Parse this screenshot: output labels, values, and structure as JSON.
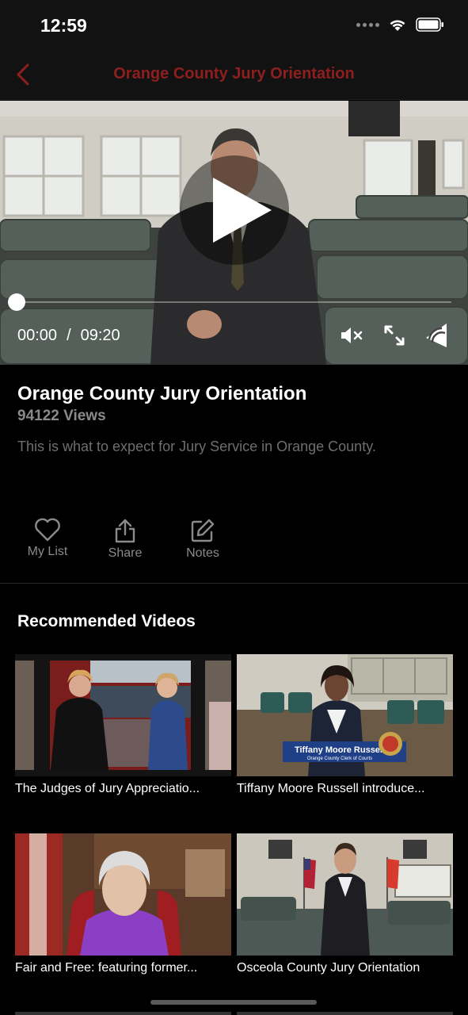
{
  "status_bar": {
    "time": "12:59"
  },
  "nav": {
    "title": "Orange County Jury Orientation",
    "accent": "#8f1f1f"
  },
  "player": {
    "current_time": "00:00",
    "separator": "/",
    "duration": "09:20",
    "progress": 0,
    "icons": [
      "play-icon",
      "mute-icon",
      "fullscreen-icon",
      "cast-icon"
    ]
  },
  "video": {
    "title": "Orange County Jury Orientation",
    "views": "94122 Views",
    "description": "This is what to expect for Jury Service in Orange County."
  },
  "actions": [
    {
      "label": "My List",
      "icon": "heart-icon"
    },
    {
      "label": "Share",
      "icon": "share-icon"
    },
    {
      "label": "Notes",
      "icon": "edit-icon"
    }
  ],
  "recommended": {
    "heading": "Recommended Videos",
    "items": [
      {
        "title": "The Judges of Jury Appreciatio..."
      },
      {
        "title": "Tiffany Moore Russell introduce...",
        "lower_third_name": "Tiffany Moore Russell",
        "lower_third_sub": "Orange County Clerk of Courts"
      },
      {
        "title": "Fair and Free: featuring former..."
      },
      {
        "title": "Osceola County Jury Orientation"
      }
    ]
  }
}
